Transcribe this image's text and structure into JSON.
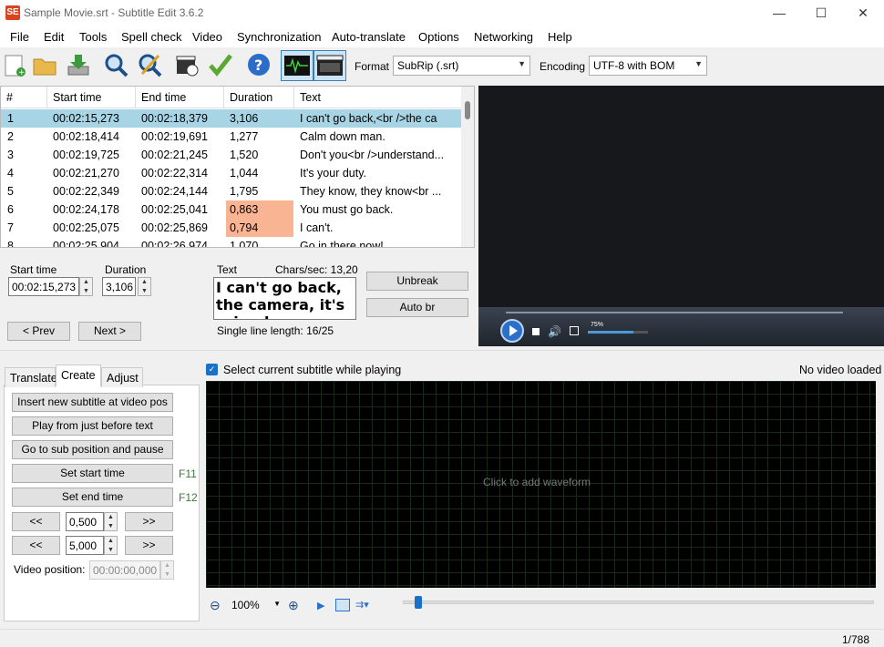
{
  "window": {
    "title": "Sample Movie.srt - Subtitle Edit 3.6.2",
    "icon_text": "SE",
    "min": "—",
    "max": "☐",
    "close": "✕"
  },
  "menu": [
    "File",
    "Edit",
    "Tools",
    "Spell check",
    "Video",
    "Synchronization",
    "Auto-translate",
    "Options",
    "Networking",
    "Help"
  ],
  "toolbar": {
    "format_label": "Format",
    "format_value": "SubRip (.srt)",
    "encoding_label": "Encoding",
    "encoding_value": "UTF-8 with BOM",
    "icons": [
      "new-file-icon",
      "open-folder-icon",
      "download-icon",
      "find-icon",
      "replace-icon",
      "visual-sync-icon",
      "spell-check-icon",
      "help-icon",
      "waveform-toggle-icon",
      "video-toggle-icon"
    ]
  },
  "grid": {
    "headers": [
      "#",
      "Start time",
      "End time",
      "Duration",
      "Text"
    ],
    "rows": [
      {
        "n": "1",
        "start": "00:02:15,273",
        "end": "00:02:18,379",
        "dur": "3,106",
        "text": "I can't go back,<br />the ca",
        "selected": true,
        "warn": false
      },
      {
        "n": "2",
        "start": "00:02:18,414",
        "end": "00:02:19,691",
        "dur": "1,277",
        "text": "Calm down man.",
        "selected": false,
        "warn": false
      },
      {
        "n": "3",
        "start": "00:02:19,725",
        "end": "00:02:21,245",
        "dur": "1,520",
        "text": "Don't you<br />understand...",
        "selected": false,
        "warn": false
      },
      {
        "n": "4",
        "start": "00:02:21,270",
        "end": "00:02:22,314",
        "dur": "1,044",
        "text": "It's your duty.",
        "selected": false,
        "warn": false
      },
      {
        "n": "5",
        "start": "00:02:22,349",
        "end": "00:02:24,144",
        "dur": "1,795",
        "text": "They know, they know<br ...",
        "selected": false,
        "warn": false
      },
      {
        "n": "6",
        "start": "00:02:24,178",
        "end": "00:02:25,041",
        "dur": "0,863",
        "text": "You must go back.",
        "selected": false,
        "warn": true
      },
      {
        "n": "7",
        "start": "00:02:25,075",
        "end": "00:02:25,869",
        "dur": "0,794",
        "text": "I can't.",
        "selected": false,
        "warn": true
      },
      {
        "n": "8",
        "start": "00:02:25,904",
        "end": "00:02:26,974",
        "dur": "1,070",
        "text": "Go in there now!",
        "selected": false,
        "warn": false
      }
    ]
  },
  "edit": {
    "start_label": "Start time",
    "start_value": "00:02:15,273",
    "duration_label": "Duration",
    "duration_value": "3,106",
    "text_label": "Text",
    "chars_sec": "Chars/sec: 13,20",
    "text_value": "I can't go back, the camera, it's ruined",
    "single_line": "Single line length: 16/25",
    "unbreak": "Unbreak",
    "autobr": "Auto br",
    "prev": "< Prev",
    "next": "Next >"
  },
  "video": {
    "volume": "75%",
    "volume_level": 0.75,
    "no_video": "No video loaded"
  },
  "tabs": [
    "Translate",
    "Create",
    "Adjust"
  ],
  "create": {
    "insert": "Insert new subtitle at video pos",
    "play_before": "Play from just before text",
    "goto_pause": "Go to sub position and pause",
    "set_start": "Set start time",
    "set_start_key": "F11",
    "set_end": "Set end time",
    "set_end_key": "F12",
    "back": "<<",
    "fwd": ">>",
    "step1": "0,500",
    "step2": "5,000",
    "video_pos_label": "Video position:",
    "video_pos": "00:00:00,000"
  },
  "waveform": {
    "checkbox": "Select current subtitle while playing",
    "click_text": "Click to add waveform",
    "zoom": "100%"
  },
  "status": {
    "count": "1/788"
  }
}
